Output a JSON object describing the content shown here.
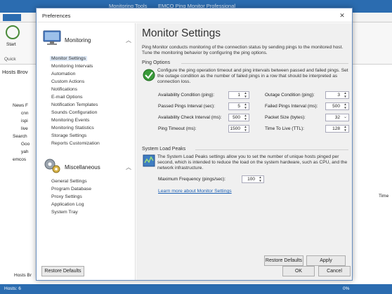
{
  "app": {
    "title_tab": "Monitoring Tools",
    "title": "EMCO Ping Monitor Professional",
    "ribbon_start": "Start",
    "ribbon_quick": "Quick",
    "hosts_panel_title": "Hosts Brov",
    "tree": [
      "News F",
      "cnn",
      "ispi",
      "live",
      "Search",
      "Goo",
      "yah",
      "emcos"
    ],
    "status_hosts": "Hosts: 6",
    "status_pct": "0%",
    "bottom_tab": "Hosts Br",
    "right_col": "Time"
  },
  "dialog": {
    "title": "Preferences",
    "nav": {
      "monitoring_header": "Monitoring",
      "monitoring_items": [
        "Monitor Settings",
        "Monitoring Intervals",
        "Automation",
        "Custom Actions",
        "Notifications",
        "E-mail Options",
        "Notification Templates",
        "Sounds Configuration",
        "Monitoring Events",
        "Monitoring Statistics",
        "Storage Settings",
        "Reports Customization"
      ],
      "misc_header": "Miscellaneous",
      "misc_items": [
        "General Settings",
        "Program Database",
        "Proxy Settings",
        "Application Log",
        "System Tray"
      ]
    },
    "page": {
      "title": "Monitor Settings",
      "intro": "Ping Monitor conducts monitoring of the connection status by sending pings to the monitored host. Tune the monitoring behavior by configuring the ping options.",
      "ping_group": "Ping Options",
      "ping_desc": "Configure the ping operation timeout and ping intervals between passed and failed pings. Set the outage condition as the number of failed pings in a row that should be interpreted as connection loss.",
      "fields_left": [
        {
          "label": "Availability Condition (ping):",
          "value": "1"
        },
        {
          "label": "Passed Pings Interval (sec):",
          "value": "5"
        },
        {
          "label": "Availability Check Interval (ms):",
          "value": "500"
        },
        {
          "label": "Ping Timeout (ms):",
          "value": "1500"
        }
      ],
      "fields_right": [
        {
          "label": "Outage Condition (ping):",
          "value": "3"
        },
        {
          "label": "Failed Pings Interval (ms):",
          "value": "500"
        },
        {
          "label": "Packet Size (bytes):",
          "value": "32"
        },
        {
          "label": "Time To Live (TTL):",
          "value": "128"
        }
      ],
      "load_group": "System Load Peaks",
      "load_desc": "The System Load Peaks settings allow you to set the number of unique hosts pinged per second, which is intended to reduce the load on the system hardware, such as CPU, and the network infrastructure.",
      "max_freq_label": "Maximum Frequency (pings/sec):",
      "max_freq_value": "100",
      "learn_more": "Learn more about Monitor Settings",
      "restore_defaults": "Restore Defaults",
      "apply": "Apply"
    },
    "footer": {
      "restore_defaults": "Restore Defaults",
      "ok": "OK",
      "cancel": "Cancel"
    }
  }
}
